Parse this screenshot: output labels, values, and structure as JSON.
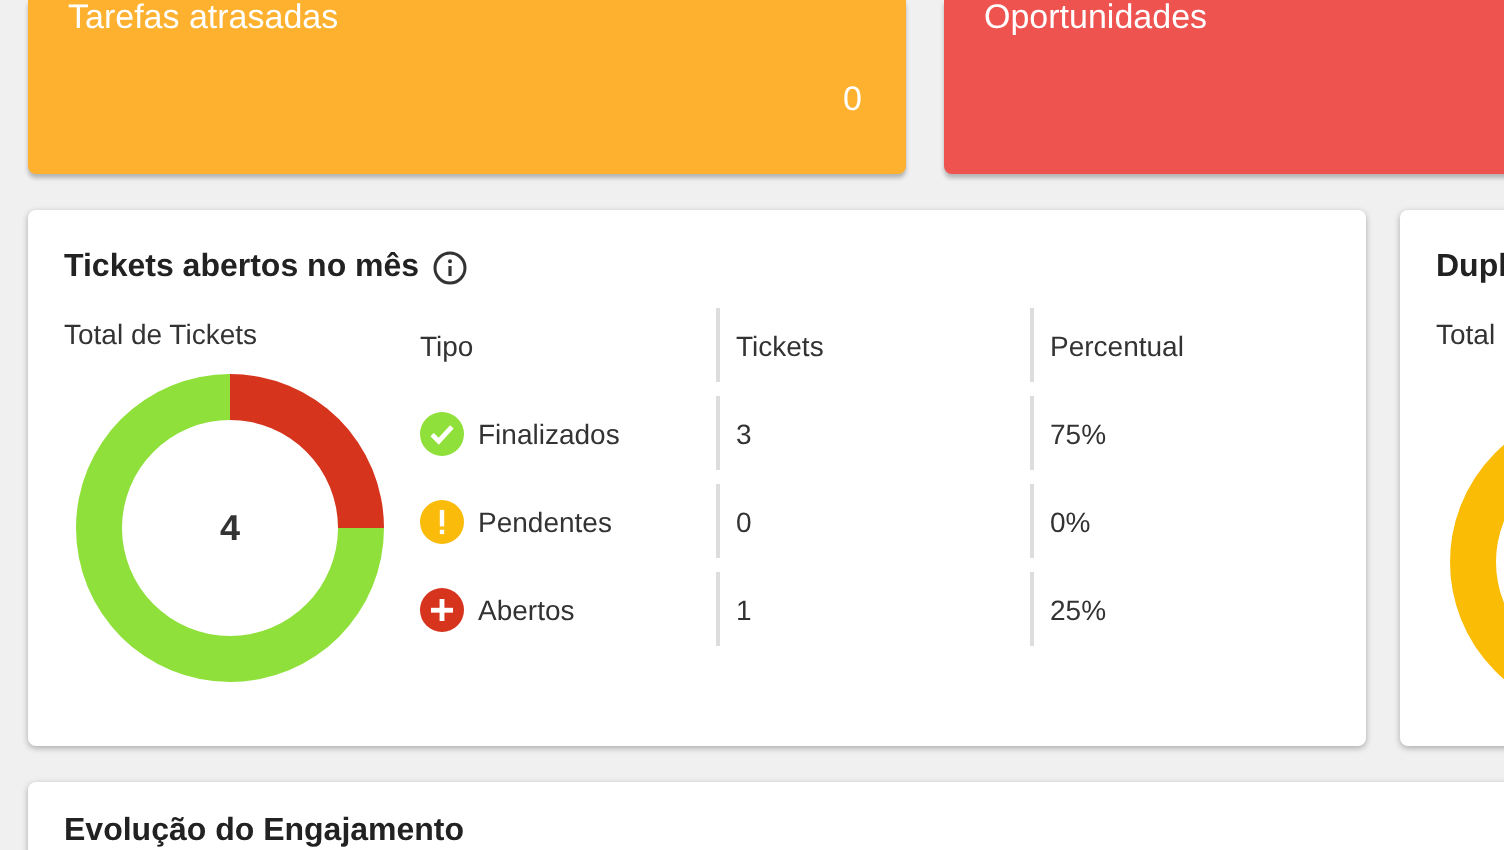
{
  "summary_cards": [
    {
      "title": "Tarefas atrasadas",
      "value": "0",
      "color": "#fdb12f"
    },
    {
      "title": "Oportunidades",
      "color": "#ef5350"
    }
  ],
  "tickets_card": {
    "title": "Tickets abertos no mês",
    "donut_label": "Total de Tickets",
    "total": "4",
    "chart_data": {
      "type": "donut",
      "values": [
        75,
        0,
        25
      ]
    },
    "columns": [
      "Tipo",
      "Tickets",
      "Percentual"
    ],
    "rows": [
      {
        "kind": "done",
        "type": "Finalizados",
        "tickets": "3",
        "percent": "75%",
        "color": "#8fe03a"
      },
      {
        "kind": "pending",
        "type": "Pendentes",
        "tickets": "0",
        "percent": "0%",
        "color": "#fbbb0b"
      },
      {
        "kind": "open",
        "type": "Abertos",
        "tickets": "1",
        "percent": "25%",
        "color": "#d7341d"
      }
    ]
  },
  "side_card": {
    "title": "Dupl",
    "donut_label": "Total"
  },
  "engagement_card": {
    "title": "Evolução do Engajamento"
  }
}
